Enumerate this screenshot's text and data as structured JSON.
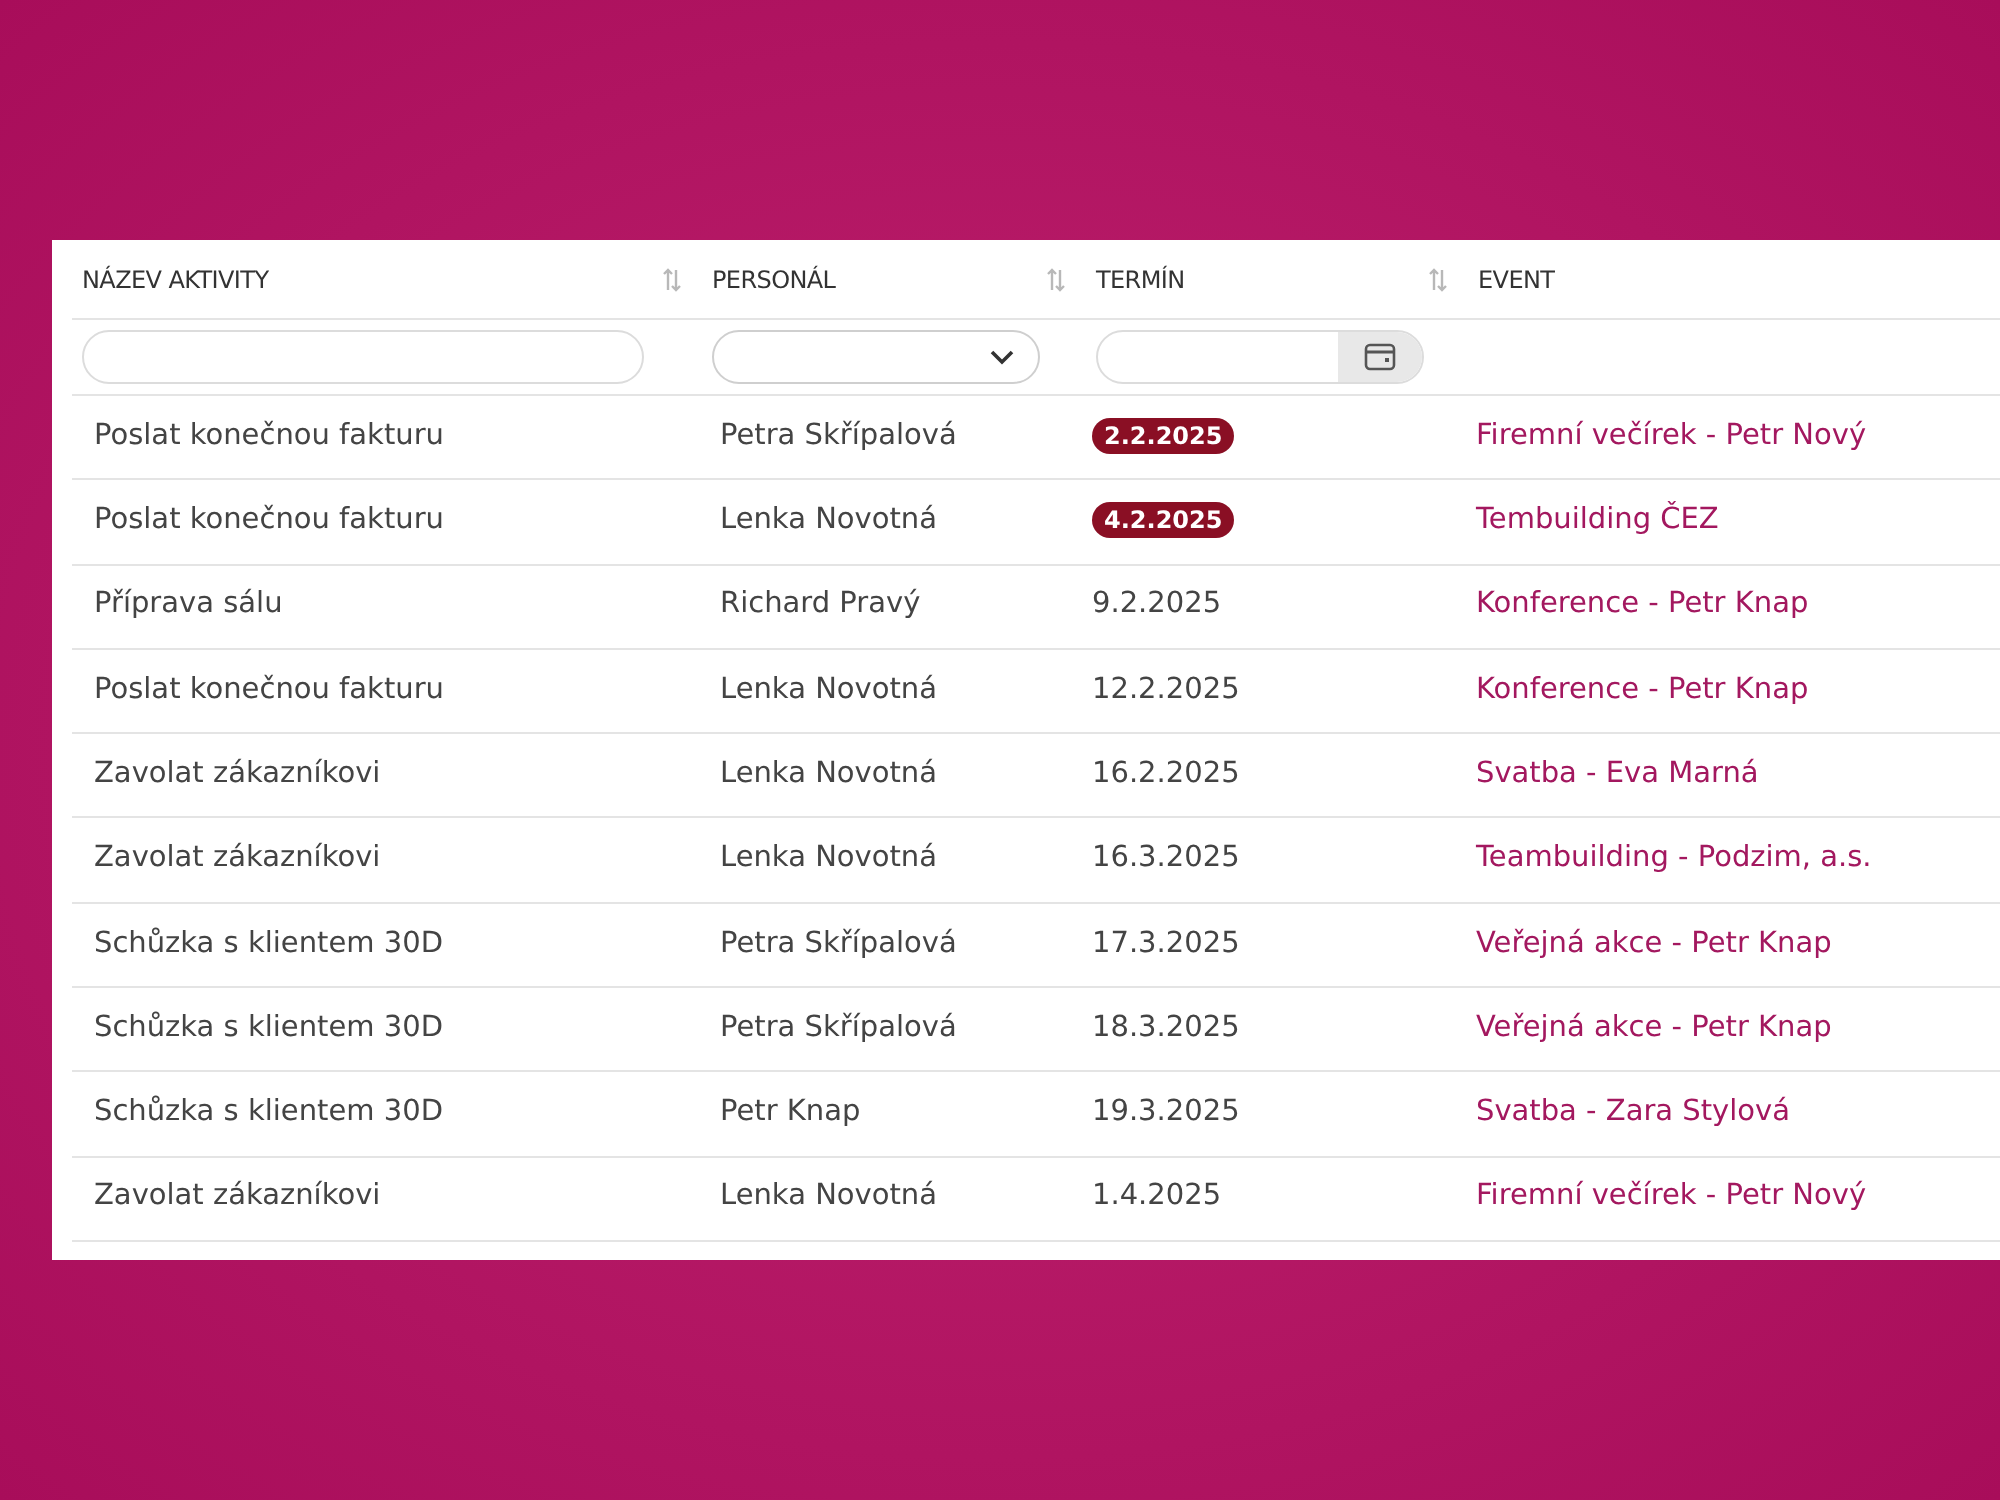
{
  "table": {
    "columns": [
      {
        "label": "NÁZEV AKTIVITY",
        "sortable": true
      },
      {
        "label": "PERSONÁL",
        "sortable": true
      },
      {
        "label": "TERMÍN",
        "sortable": true
      },
      {
        "label": "EVENT",
        "sortable": false
      }
    ],
    "filters": [
      {
        "kind": "text"
      },
      {
        "kind": "select"
      },
      {
        "kind": "date"
      },
      {
        "kind": "none"
      }
    ],
    "rows": [
      {
        "activity": "Poslat konečnou fakturu",
        "staff": "Petra Skřípalová",
        "date": "2.2.2025",
        "overdue": true,
        "event": "Firemní večírek - Petr Nový"
      },
      {
        "activity": "Poslat konečnou fakturu",
        "staff": "Lenka Novotná",
        "date": "4.2.2025",
        "overdue": true,
        "event": "Tembuilding ČEZ"
      },
      {
        "activity": "Příprava sálu",
        "staff": "Richard Pravý",
        "date": "9.2.2025",
        "overdue": false,
        "event": "Konference - Petr Knap"
      },
      {
        "activity": "Poslat konečnou fakturu",
        "staff": "Lenka Novotná",
        "date": "12.2.2025",
        "overdue": false,
        "event": "Konference - Petr Knap"
      },
      {
        "activity": "Zavolat zákazníkovi",
        "staff": "Lenka Novotná",
        "date": "16.2.2025",
        "overdue": false,
        "event": "Svatba - Eva Marná"
      },
      {
        "activity": "Zavolat zákazníkovi",
        "staff": "Lenka Novotná",
        "date": "16.3.2025",
        "overdue": false,
        "event": "Teambuilding - Podzim, a.s."
      },
      {
        "activity": "Schůzka s klientem 30D",
        "staff": "Petra Skřípalová",
        "date": "17.3.2025",
        "overdue": false,
        "event": "Veřejná akce - Petr Knap"
      },
      {
        "activity": "Schůzka s klientem 30D",
        "staff": "Petra Skřípalová",
        "date": "18.3.2025",
        "overdue": false,
        "event": "Veřejná akce - Petr Knap"
      },
      {
        "activity": "Schůzka s klientem 30D",
        "staff": "Petr Knap",
        "date": "19.3.2025",
        "overdue": false,
        "event": "Svatba - Zara Stylová"
      },
      {
        "activity": "Zavolat zákazníkovi",
        "staff": "Lenka Novotná",
        "date": "1.4.2025",
        "overdue": false,
        "event": "Firemní večírek - Petr Nový"
      }
    ]
  }
}
